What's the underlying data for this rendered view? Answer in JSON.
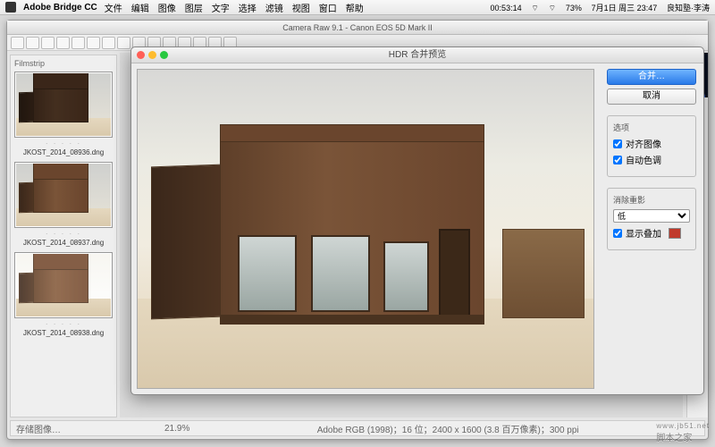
{
  "menubar": {
    "app": "Adobe Bridge CC",
    "items": [
      "文件",
      "编辑",
      "图像",
      "图层",
      "文字",
      "选择",
      "滤镜",
      "视图",
      "窗口",
      "帮助"
    ],
    "time": "00:53:14",
    "battery": "73%",
    "date": "7月1日 周三 23:47",
    "user": "良知塾·李涛"
  },
  "acr": {
    "title": "Camera Raw 9.1 - Canon EOS 5D Mark II",
    "footer_left": "存储图像…",
    "zoom": "21.9%",
    "info": "Adobe RGB (1998)；16 位；2400 x 1600 (3.8 百万像素)；300 ppi"
  },
  "filmstrip": {
    "header": "Filmstrip",
    "items": [
      {
        "caption": "JKOST_2014_08936.dng"
      },
      {
        "caption": "JKOST_2014_08937.dng"
      },
      {
        "caption": "JKOST_2014_08938.dng"
      }
    ]
  },
  "hdr": {
    "title": "HDR 合并预览",
    "merge_btn": "合并…",
    "cancel_btn": "取消",
    "options_label": "选项",
    "align": "对齐图像",
    "autotone": "自动色调",
    "deghost_label": "消除重影",
    "deghost_level": "低",
    "show_overlay": "显示叠加"
  },
  "watermark": {
    "main": "脚本之家",
    "sub": "www.jb51.net"
  }
}
